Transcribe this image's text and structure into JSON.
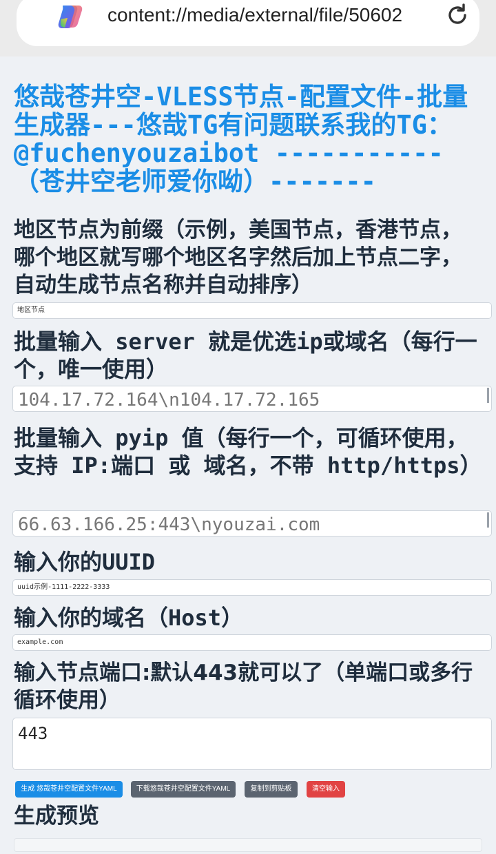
{
  "browser": {
    "url": "content://media/external/file/50602"
  },
  "page": {
    "title": "悠哉苍井空-VLESS节点-配置文件-批量生成器---悠哉TG有问题联系我的TG：@fuchenyouzaibot -----------（苍井空老师爱你呦）-------",
    "region": {
      "label": "地区节点为前缀（示例，美国节点，香港节点，哪个地区就写哪个地区名字然后加上节点二字，自动生成节点名称并自动排序）",
      "value": "地区节点"
    },
    "server": {
      "label": "批量输入 server 就是优选ip或域名（每行一个，唯一使用）",
      "placeholder": "104.17.72.164\\n104.17.72.165"
    },
    "pyip": {
      "label": "批量输入 pyip 值（每行一个，可循环使用，支持 IP:端口 或 域名，不带 http/https）",
      "placeholder": "66.63.166.25:443\\nyouzai.com"
    },
    "uuid": {
      "label": "输入你的UUID",
      "value": "uuid示例-1111-2222-3333"
    },
    "host": {
      "label": "输入你的域名（Host）",
      "value": "example.com"
    },
    "port": {
      "label": "输入节点端口:默认443就可以了（单端口或多行循环使用）",
      "value": "443"
    },
    "buttons": {
      "generate": "生成 悠哉苍井空配置文件YAML",
      "download": "下载悠哉苍井空配置文件YAML",
      "copy": "复制到剪贴板",
      "clear": "清空输入"
    },
    "preview": {
      "label": "生成预览"
    }
  },
  "colors": {
    "accent": "#1a8de6",
    "button_gray": "#5b6470",
    "button_red": "#e14343",
    "text": "#1f2d3d"
  },
  "icons": {
    "app_logo": "copilot-logo-icon",
    "reload": "reload-icon"
  }
}
